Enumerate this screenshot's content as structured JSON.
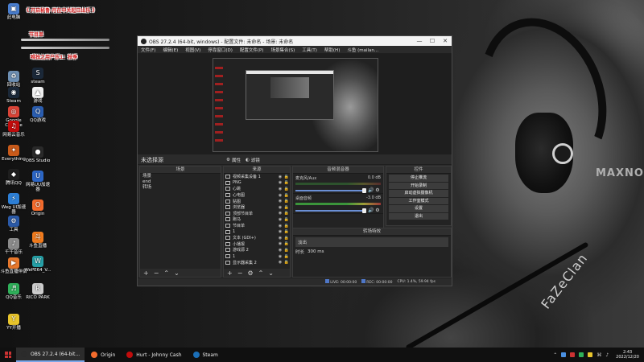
{
  "desktop": {
    "banners": {
      "top": "《 开启秘鲁·月在中关起日出乐 》",
      "mid_label": "节目单",
      "bottom": "唯独之用户乐1：秋季"
    },
    "icons_left": [
      {
        "label": "此电脑",
        "color": "#4a7fd0",
        "glyph": "▣"
      },
      {
        "label": "回收站",
        "color": "#6d8fb3",
        "glyph": "♻"
      },
      {
        "label": "Steam",
        "color": "#1b2838",
        "glyph": "◉"
      },
      {
        "label": "Google Chrome",
        "color": "#db4437",
        "glyph": "◎"
      },
      {
        "label": "网易云音乐",
        "color": "#c20c0c",
        "glyph": "♫"
      },
      {
        "label": "Everything",
        "color": "#c85a1a",
        "glyph": "✦"
      },
      {
        "label": "腾讯QQ",
        "color": "#1e1e1e",
        "glyph": "◆"
      },
      {
        "label": "Weg UI加速器",
        "color": "#2d7fd6",
        "glyph": "⚡"
      },
      {
        "label": "工具",
        "color": "#2b5aa8",
        "glyph": "⚙"
      },
      {
        "label": "千千音乐",
        "color": "#8a8a8a",
        "glyph": "♪"
      },
      {
        "label": "斗鱼直播伴侣",
        "color": "#e8782c",
        "glyph": "▶"
      },
      {
        "label": "QQ音乐",
        "color": "#2fb05a",
        "glyph": "♬"
      },
      {
        "label": "YY开播",
        "color": "#e8c52c",
        "glyph": "Y"
      }
    ],
    "icons_right": [
      {
        "label": "steam",
        "color": "#1b2838",
        "glyph": "S"
      },
      {
        "label": "游戏",
        "color": "#f0f0f0",
        "glyph": "▲"
      },
      {
        "label": "QQ游戏",
        "color": "#2a5db0",
        "glyph": "Q"
      },
      {
        "label": "OBS Studio",
        "color": "#2a2a2a",
        "glyph": "●"
      },
      {
        "label": "网易UU加速器",
        "color": "#2c67c7",
        "glyph": "U"
      },
      {
        "label": "Origin",
        "color": "#f56c2d",
        "glyph": "O"
      },
      {
        "label": "斗鱼直播",
        "color": "#f07b1e",
        "glyph": "斗"
      },
      {
        "label": "WePE64_V...",
        "color": "#26a0a7",
        "glyph": "W"
      },
      {
        "label": "RICO PARK",
        "color": "#cccccc",
        "glyph": "R"
      }
    ],
    "wallpaper_text": {
      "shirt": "FaZeClan",
      "chair": "MAXNO"
    }
  },
  "obs": {
    "title": "OBS 27.2.4 (64-bit, windows) - 配置文件: 未命名 - 场景: 未命名",
    "menu": [
      "文件(F)",
      "编辑(E)",
      "视图(V)",
      "停靠窗口(D)",
      "配置文件(P)",
      "场景集合(S)",
      "工具(T)",
      "帮助(H)",
      "斗鱼 (mailan..."
    ],
    "scene_bar": {
      "label": "未选择源",
      "properties": "属性",
      "filters": "滤镜"
    },
    "docks": {
      "scenes": {
        "title": "场景",
        "items": [
          "场景",
          "end",
          "转场"
        ]
      },
      "sources": {
        "title": "来源",
        "items": [
          "视频采集设备 1",
          "PNG",
          "心跳",
          "心电图",
          "贴图",
          "浏览器",
          "顶部节目单",
          "跑马",
          "节目单",
          "1",
          "文本 (GDI+)",
          "小播报",
          "游戏源 2",
          "1",
          "显示器采集 2"
        ]
      },
      "mixer": {
        "title": "音频混音器",
        "tracks": [
          {
            "name": "麦克风/Aux",
            "db": "0.0 dB"
          },
          {
            "name": "桌面音频",
            "db": "-3.0 dB"
          }
        ]
      },
      "transitions": {
        "title": "转场特效",
        "selected": "淡出",
        "duration_label": "时长",
        "duration": "300 ms"
      },
      "controls": {
        "title": "控件",
        "buttons": [
          "停止推流",
          "开始录制",
          "启动虚拟摄像机",
          "工作室模式",
          "设置",
          "退出"
        ]
      }
    },
    "status": {
      "live": "LIVE: 00:00:00",
      "rec": "REC: 00:00:00",
      "cpu": "CPU: 1.4%, 59.94 fps"
    },
    "window_controls": {
      "min": "—",
      "max": "☐",
      "close": "✕"
    }
  },
  "taskbar": {
    "items": [
      {
        "label": "OBS 27.2.4 (64-bit...",
        "color": "#2b2b2b",
        "active": true
      },
      {
        "label": "Origin",
        "color": "#f56c2d",
        "active": false
      },
      {
        "label": "Hurt - Johnny Cash",
        "color": "#c20c0c",
        "active": false
      },
      {
        "label": "Steam",
        "color": "#1b6fb8",
        "active": false
      }
    ],
    "clock": {
      "time": "2:43",
      "date": "2022/12/20"
    }
  }
}
